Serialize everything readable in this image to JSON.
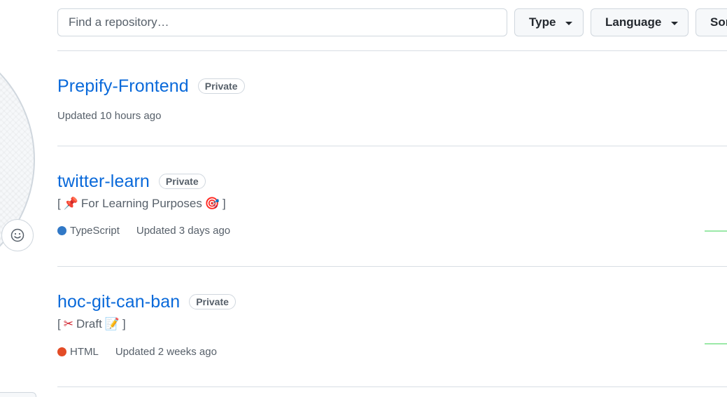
{
  "search": {
    "placeholder": "Find a repository…"
  },
  "filters": {
    "type_label": "Type",
    "language_label": "Language",
    "sort_label": "Sort"
  },
  "repos": [
    {
      "name": "Prepify-Frontend",
      "visibility": "Private",
      "description": null,
      "language": null,
      "updated": "Updated 10 hours ago"
    },
    {
      "name": "twitter-learn",
      "visibility": "Private",
      "desc_open": "[",
      "desc_icon1": "📌",
      "desc_text": "For Learning Purposes",
      "desc_icon2": "🎯",
      "desc_close": "]",
      "language": "TypeScript",
      "language_color": "#3178c6",
      "updated": "Updated 3 days ago"
    },
    {
      "name": "hoc-git-can-ban",
      "visibility": "Private",
      "desc_open": "[",
      "desc_icon1": "✂",
      "desc_text": "Draft",
      "desc_icon2": "📝",
      "desc_close": "]",
      "language": "HTML",
      "language_color": "#e34c26",
      "updated": "Updated 2 weeks ago"
    }
  ],
  "emoji_status_icon": "smiley-icon"
}
